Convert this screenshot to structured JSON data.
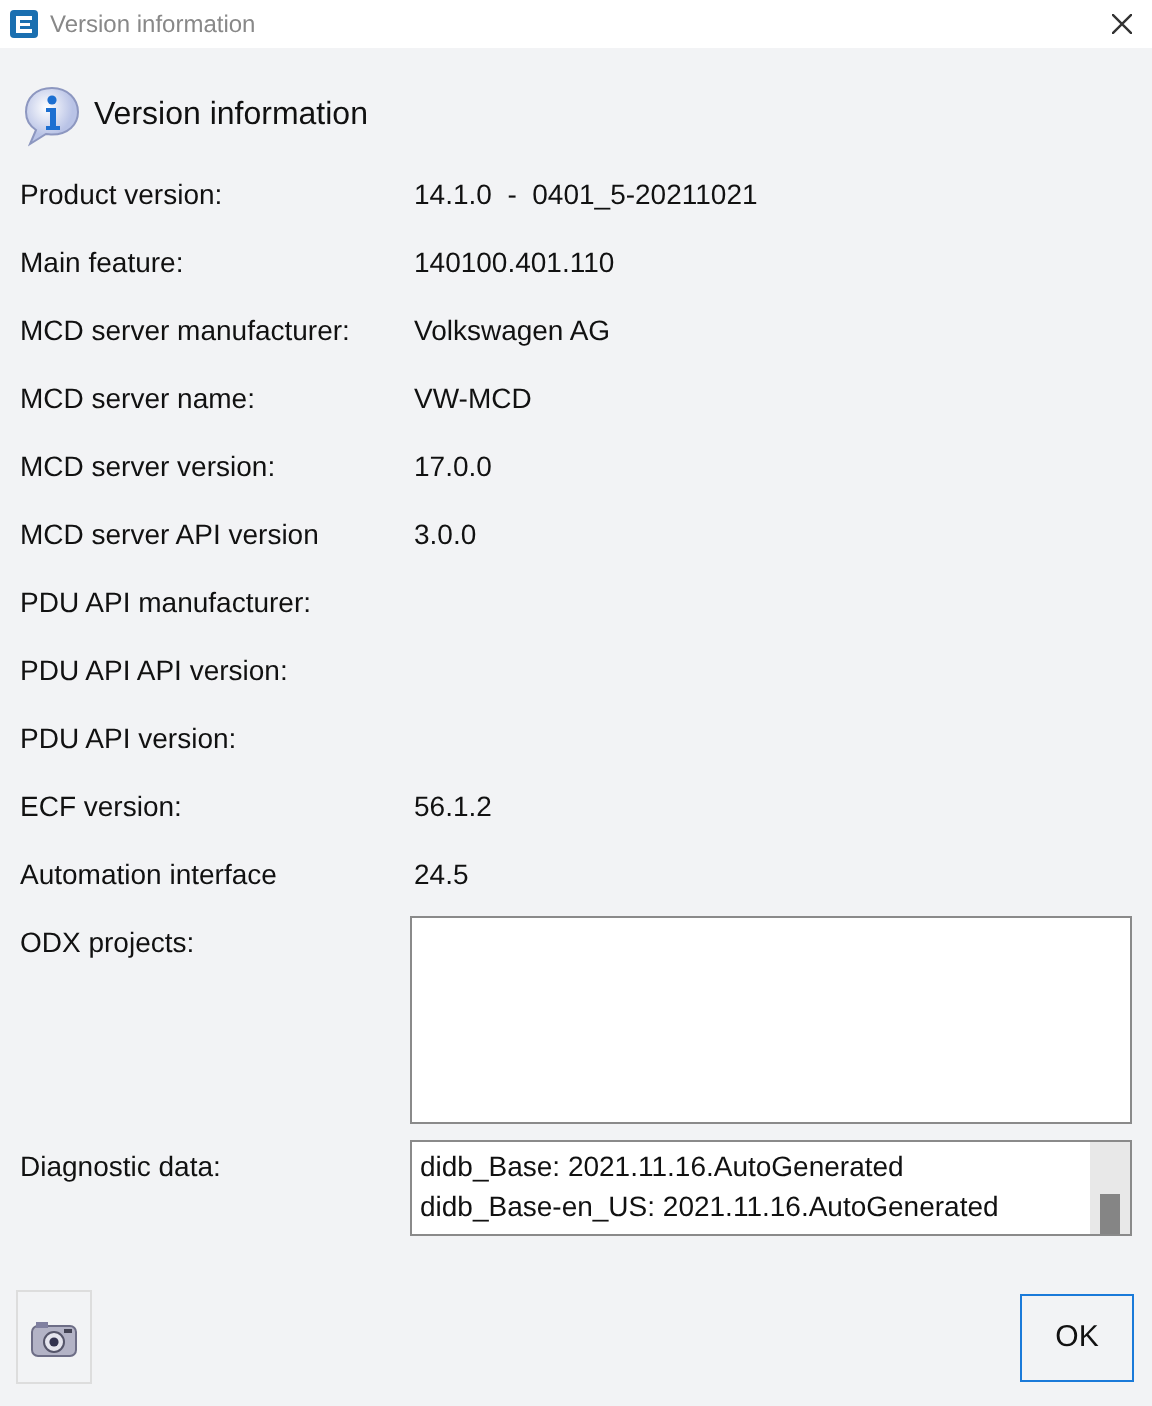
{
  "window": {
    "title": "Version information"
  },
  "heading": "Version information",
  "fields": [
    {
      "label": "Product version:",
      "value": "14.1.0  -  0401_5-20211021"
    },
    {
      "label": "Main feature:",
      "value": "140100.401.110"
    },
    {
      "label": "MCD server manufacturer:",
      "value": "Volkswagen AG"
    },
    {
      "label": "MCD server name:",
      "value": "VW-MCD"
    },
    {
      "label": "MCD server version:",
      "value": "17.0.0"
    },
    {
      "label": "MCD server API version",
      "value": "3.0.0"
    },
    {
      "label": "PDU API manufacturer:"
    },
    {
      "label": "PDU API API version:"
    },
    {
      "label": "PDU API version:"
    },
    {
      "label": "ECF version:",
      "value": "56.1.2"
    },
    {
      "label": "Automation interface",
      "value": "24.5"
    }
  ],
  "odx_projects": {
    "label": "ODX projects:"
  },
  "diagnostic_data": {
    "label": "Diagnostic data:",
    "lines": [
      "didb_Base: 2021.11.16.AutoGenerated",
      "didb_Base-en_US: 2021.11.16.AutoGenerated"
    ]
  },
  "buttons": [
    {
      "label": "OK"
    }
  ]
}
